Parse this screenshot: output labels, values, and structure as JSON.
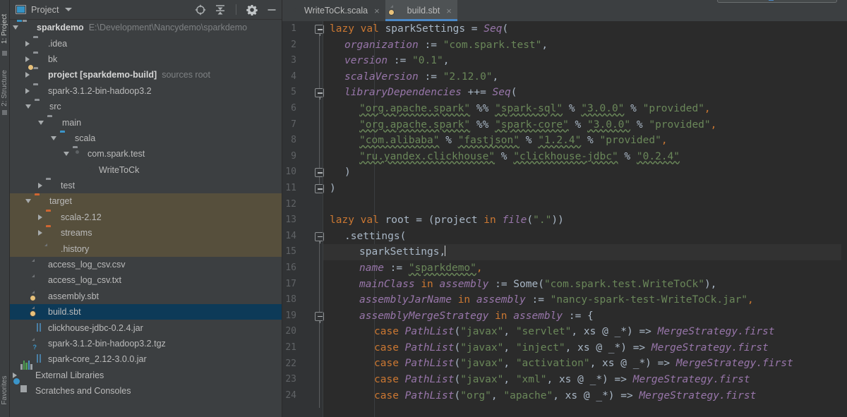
{
  "left_strip": {
    "tabs": [
      {
        "label": "1: Project",
        "selected": true
      },
      {
        "label": "2: Structure",
        "selected": false
      },
      {
        "label": "Favorites",
        "selected": false
      }
    ]
  },
  "project_panel": {
    "title": "Project",
    "icons": [
      {
        "name": "locate-icon",
        "glyph": "⊕"
      },
      {
        "name": "collapse-all-icon",
        "glyph": "⤓"
      },
      {
        "name": "settings-gear-icon",
        "glyph": "⚙"
      },
      {
        "name": "hide-icon",
        "glyph": "—"
      }
    ],
    "tree": [
      {
        "indent": 0,
        "arrow": "down",
        "icon": "folder-module",
        "label": "sparkdemo",
        "bold": true,
        "sub": "E:\\Development\\Nancydemo\\sparkdemo"
      },
      {
        "indent": 1,
        "arrow": "right",
        "icon": "folder",
        "label": ".idea"
      },
      {
        "indent": 1,
        "arrow": "right",
        "icon": "folder",
        "label": "bk"
      },
      {
        "indent": 1,
        "arrow": "right",
        "icon": "folder-src",
        "label": "project [sparkdemo-build]",
        "bold": true,
        "sub": "sources root"
      },
      {
        "indent": 1,
        "arrow": "right",
        "icon": "folder",
        "label": "spark-3.1.2-bin-hadoop3.2"
      },
      {
        "indent": 1,
        "arrow": "down",
        "icon": "folder",
        "label": "src"
      },
      {
        "indent": 2,
        "arrow": "down",
        "icon": "folder",
        "label": "main"
      },
      {
        "indent": 3,
        "arrow": "down",
        "icon": "folder-blue",
        "label": "scala"
      },
      {
        "indent": 4,
        "arrow": "down",
        "icon": "folder-package",
        "label": "com.spark.test"
      },
      {
        "indent": 5,
        "arrow": "none",
        "icon": "scala-object",
        "label": "WriteToCk"
      },
      {
        "indent": 2,
        "arrow": "right",
        "icon": "folder",
        "label": "test"
      },
      {
        "indent": 1,
        "arrow": "down",
        "icon": "folder-orange",
        "label": "target",
        "excluded": true
      },
      {
        "indent": 2,
        "arrow": "right",
        "icon": "folder-orange",
        "label": "scala-2.12",
        "excluded": true
      },
      {
        "indent": 2,
        "arrow": "right",
        "icon": "folder-orange",
        "label": "streams",
        "excluded": true
      },
      {
        "indent": 2,
        "arrow": "none",
        "icon": "file",
        "label": ".history",
        "excluded": true
      },
      {
        "indent": 1,
        "arrow": "none",
        "icon": "file",
        "label": "access_log_csv.csv"
      },
      {
        "indent": 1,
        "arrow": "none",
        "icon": "file",
        "label": "access_log_csv.txt"
      },
      {
        "indent": 1,
        "arrow": "none",
        "icon": "file-sbt",
        "label": "assembly.sbt"
      },
      {
        "indent": 1,
        "arrow": "none",
        "icon": "file-sbt",
        "label": "build.sbt",
        "selected": true
      },
      {
        "indent": 1,
        "arrow": "none",
        "icon": "jar",
        "label": "clickhouse-jdbc-0.2.4.jar"
      },
      {
        "indent": 1,
        "arrow": "none",
        "icon": "file-unknown",
        "label": "spark-3.1.2-bin-hadoop3.2.tgz"
      },
      {
        "indent": 1,
        "arrow": "none",
        "icon": "jar",
        "label": "spark-core_2.12-3.0.0.jar"
      },
      {
        "indent": 0,
        "arrow": "right",
        "icon": "external-libs",
        "label": "External Libraries"
      },
      {
        "indent": 0,
        "arrow": "none",
        "icon": "scratches",
        "label": "Scratches and Consoles"
      }
    ]
  },
  "editor": {
    "tabs": [
      {
        "label": "WriteToCk.scala",
        "icon": "scala-object-icon",
        "active": false,
        "close": "×"
      },
      {
        "label": "build.sbt",
        "icon": "sbt-file-icon",
        "active": true,
        "close": "×"
      }
    ],
    "current_line": 15,
    "first_line": 1,
    "last_line": 24,
    "lines": [
      {
        "n": 1,
        "fold": "start",
        "tokens": [
          {
            "t": "kw",
            "v": "lazy val "
          },
          {
            "t": "ident",
            "v": "sparkSettings "
          },
          {
            "t": "op",
            "v": "= "
          },
          {
            "t": "italv",
            "v": "Seq"
          },
          {
            "t": "op",
            "v": "("
          }
        ],
        "indent": 0
      },
      {
        "n": 2,
        "fold": "",
        "tokens": [
          {
            "t": "fn",
            "v": "organization "
          },
          {
            "t": "op",
            "v": ":= "
          },
          {
            "t": "str",
            "v": "\"com.spark.test\""
          },
          {
            "t": "op",
            "v": ","
          }
        ],
        "indent": 1
      },
      {
        "n": 3,
        "fold": "",
        "tokens": [
          {
            "t": "fn",
            "v": "version "
          },
          {
            "t": "op",
            "v": ":= "
          },
          {
            "t": "str",
            "v": "\"0.1\""
          },
          {
            "t": "op",
            "v": ","
          }
        ],
        "indent": 1
      },
      {
        "n": 4,
        "fold": "",
        "tokens": [
          {
            "t": "fn",
            "v": "scalaVersion "
          },
          {
            "t": "op",
            "v": ":= "
          },
          {
            "t": "str",
            "v": "\"2.12.0\""
          },
          {
            "t": "op",
            "v": ","
          }
        ],
        "indent": 1
      },
      {
        "n": 5,
        "fold": "start",
        "tokens": [
          {
            "t": "fn",
            "v": "libraryDependencies "
          },
          {
            "t": "op",
            "v": "++= "
          },
          {
            "t": "italv",
            "v": "Seq"
          },
          {
            "t": "op",
            "v": "("
          }
        ],
        "indent": 1
      },
      {
        "n": 6,
        "fold": "",
        "tokens": [
          {
            "t": "u-str",
            "v": "\"org.apache.spark\""
          },
          {
            "t": "op",
            "v": " %% "
          },
          {
            "t": "u-str",
            "v": "\"spark-sql\""
          },
          {
            "t": "op",
            "v": " % "
          },
          {
            "t": "u-str",
            "v": "\"3.0.0\""
          },
          {
            "t": "op",
            "v": " % "
          },
          {
            "t": "str",
            "v": "\"provided\""
          },
          {
            "t": "warn",
            "v": ","
          }
        ],
        "indent": 2
      },
      {
        "n": 7,
        "fold": "",
        "tokens": [
          {
            "t": "u-str",
            "v": "\"org.apache.spark\""
          },
          {
            "t": "op",
            "v": " %% "
          },
          {
            "t": "u-str",
            "v": "\"spark-core\""
          },
          {
            "t": "op",
            "v": " % "
          },
          {
            "t": "u-str",
            "v": "\"3.0.0\""
          },
          {
            "t": "op",
            "v": " % "
          },
          {
            "t": "str",
            "v": "\"provided\""
          },
          {
            "t": "warn",
            "v": ","
          }
        ],
        "indent": 2
      },
      {
        "n": 8,
        "fold": "",
        "tokens": [
          {
            "t": "u-str",
            "v": "\"com.alibaba\""
          },
          {
            "t": "op",
            "v": " % "
          },
          {
            "t": "u-str",
            "v": "\"fastjson\""
          },
          {
            "t": "op",
            "v": " % "
          },
          {
            "t": "u-str",
            "v": "\"1.2.4\""
          },
          {
            "t": "op",
            "v": " % "
          },
          {
            "t": "str",
            "v": "\"provided\""
          },
          {
            "t": "warn",
            "v": ","
          }
        ],
        "indent": 2
      },
      {
        "n": 9,
        "fold": "",
        "tokens": [
          {
            "t": "u-str",
            "v": "\"ru.yandex.clickhouse\""
          },
          {
            "t": "op",
            "v": " % "
          },
          {
            "t": "u-str",
            "v": "\"clickhouse-jdbc\""
          },
          {
            "t": "op",
            "v": " % "
          },
          {
            "t": "u-str",
            "v": "\"0.2.4\""
          }
        ],
        "indent": 2
      },
      {
        "n": 10,
        "fold": "end",
        "tokens": [
          {
            "t": "op",
            "v": ")"
          }
        ],
        "indent": 1
      },
      {
        "n": 11,
        "fold": "end",
        "tokens": [
          {
            "t": "op",
            "v": ")"
          }
        ],
        "indent": 0
      },
      {
        "n": 12,
        "fold": "",
        "tokens": [],
        "indent": 0
      },
      {
        "n": 13,
        "fold": "",
        "tokens": [
          {
            "t": "kw",
            "v": "lazy val "
          },
          {
            "t": "ident",
            "v": "root "
          },
          {
            "t": "op",
            "v": "= ("
          },
          {
            "t": "ident",
            "v": "project "
          },
          {
            "t": "kw",
            "v": "in "
          },
          {
            "t": "fn",
            "v": "file"
          },
          {
            "t": "op",
            "v": "("
          },
          {
            "t": "str",
            "v": "\".\""
          },
          {
            "t": "op",
            "v": "))"
          }
        ],
        "indent": 0
      },
      {
        "n": 14,
        "fold": "start",
        "tokens": [
          {
            "t": "op",
            "v": ".settings("
          }
        ],
        "indent": 1
      },
      {
        "n": 15,
        "fold": "",
        "tokens": [
          {
            "t": "ident",
            "v": "sparkSettings"
          },
          {
            "t": "op",
            "v": ","
          },
          {
            "t": "caret",
            "v": ""
          }
        ],
        "indent": 2,
        "current": true
      },
      {
        "n": 16,
        "fold": "",
        "tokens": [
          {
            "t": "fn",
            "v": "name "
          },
          {
            "t": "op",
            "v": ":= "
          },
          {
            "t": "u-str",
            "v": "\"sparkdemo\""
          },
          {
            "t": "warn",
            "v": ","
          }
        ],
        "indent": 2
      },
      {
        "n": 17,
        "fold": "",
        "tokens": [
          {
            "t": "fn",
            "v": "mainClass "
          },
          {
            "t": "kw",
            "v": "in "
          },
          {
            "t": "fn",
            "v": "assembly "
          },
          {
            "t": "op",
            "v": ":= "
          },
          {
            "t": "cls",
            "v": "Some"
          },
          {
            "t": "op",
            "v": "("
          },
          {
            "t": "str",
            "v": "\"com.spark.test.WriteToCk\""
          },
          {
            "t": "op",
            "v": "),"
          }
        ],
        "indent": 2
      },
      {
        "n": 18,
        "fold": "",
        "tokens": [
          {
            "t": "fn",
            "v": "assemblyJarName "
          },
          {
            "t": "kw",
            "v": "in "
          },
          {
            "t": "fn",
            "v": "assembly "
          },
          {
            "t": "op",
            "v": ":= "
          },
          {
            "t": "str",
            "v": "\"nancy-spark-test-WriteToCk.jar\""
          },
          {
            "t": "warn",
            "v": ","
          }
        ],
        "indent": 2
      },
      {
        "n": 19,
        "fold": "start",
        "tokens": [
          {
            "t": "fn",
            "v": "assemblyMergeStrategy "
          },
          {
            "t": "kw",
            "v": "in "
          },
          {
            "t": "fn",
            "v": "assembly "
          },
          {
            "t": "op",
            "v": ":= {"
          }
        ],
        "indent": 2
      },
      {
        "n": 20,
        "fold": "",
        "tokens": [
          {
            "t": "kw",
            "v": "case "
          },
          {
            "t": "fn",
            "v": "PathList"
          },
          {
            "t": "op",
            "v": "("
          },
          {
            "t": "str",
            "v": "\"javax\""
          },
          {
            "t": "op",
            "v": ", "
          },
          {
            "t": "str",
            "v": "\"servlet\""
          },
          {
            "t": "op",
            "v": ", "
          },
          {
            "t": "ident",
            "v": "xs "
          },
          {
            "t": "op",
            "v": "@ _*) => "
          },
          {
            "t": "fn",
            "v": "MergeStrategy.first"
          }
        ],
        "indent": 3
      },
      {
        "n": 21,
        "fold": "",
        "tokens": [
          {
            "t": "kw",
            "v": "case "
          },
          {
            "t": "fn",
            "v": "PathList"
          },
          {
            "t": "op",
            "v": "("
          },
          {
            "t": "str",
            "v": "\"javax\""
          },
          {
            "t": "op",
            "v": ", "
          },
          {
            "t": "str",
            "v": "\"inject\""
          },
          {
            "t": "op",
            "v": ", "
          },
          {
            "t": "ident",
            "v": "xs "
          },
          {
            "t": "op",
            "v": "@ _*) => "
          },
          {
            "t": "fn",
            "v": "MergeStrategy.first"
          }
        ],
        "indent": 3
      },
      {
        "n": 22,
        "fold": "",
        "tokens": [
          {
            "t": "kw",
            "v": "case "
          },
          {
            "t": "fn",
            "v": "PathList"
          },
          {
            "t": "op",
            "v": "("
          },
          {
            "t": "str",
            "v": "\"javax\""
          },
          {
            "t": "op",
            "v": ", "
          },
          {
            "t": "str",
            "v": "\"activation\""
          },
          {
            "t": "op",
            "v": ", "
          },
          {
            "t": "ident",
            "v": "xs "
          },
          {
            "t": "op",
            "v": "@ _*) => "
          },
          {
            "t": "fn",
            "v": "MergeStrategy.first"
          }
        ],
        "indent": 3
      },
      {
        "n": 23,
        "fold": "",
        "tokens": [
          {
            "t": "kw",
            "v": "case "
          },
          {
            "t": "fn",
            "v": "PathList"
          },
          {
            "t": "op",
            "v": "("
          },
          {
            "t": "str",
            "v": "\"javax\""
          },
          {
            "t": "op",
            "v": ", "
          },
          {
            "t": "str",
            "v": "\"xml\""
          },
          {
            "t": "op",
            "v": ", "
          },
          {
            "t": "ident",
            "v": "xs "
          },
          {
            "t": "op",
            "v": "@ _*) => "
          },
          {
            "t": "fn",
            "v": "MergeStrategy.first"
          }
        ],
        "indent": 3
      },
      {
        "n": 24,
        "fold": "",
        "tokens": [
          {
            "t": "kw",
            "v": "case "
          },
          {
            "t": "fn",
            "v": "PathList"
          },
          {
            "t": "op",
            "v": "("
          },
          {
            "t": "str",
            "v": "\"org\""
          },
          {
            "t": "op",
            "v": ", "
          },
          {
            "t": "str",
            "v": "\"apache\""
          },
          {
            "t": "op",
            "v": ", "
          },
          {
            "t": "ident",
            "v": "xs "
          },
          {
            "t": "op",
            "v": "@ _*) => "
          },
          {
            "t": "fn",
            "v": "MergeStrategy.first"
          }
        ],
        "indent": 3
      }
    ]
  },
  "colors": {
    "background": "#3c3f41",
    "editor_background": "#2b2b2b",
    "gutter_background": "#313335",
    "selection_blue": "#0d3a58",
    "excluded_olive": "#564f3c",
    "accent_blue": "#4a88c7",
    "keyword_orange": "#cc7832",
    "string_green": "#6a8759",
    "identifier_gray": "#a9b7c6",
    "field_purple": "#9876aa",
    "current_line": "#323232"
  }
}
